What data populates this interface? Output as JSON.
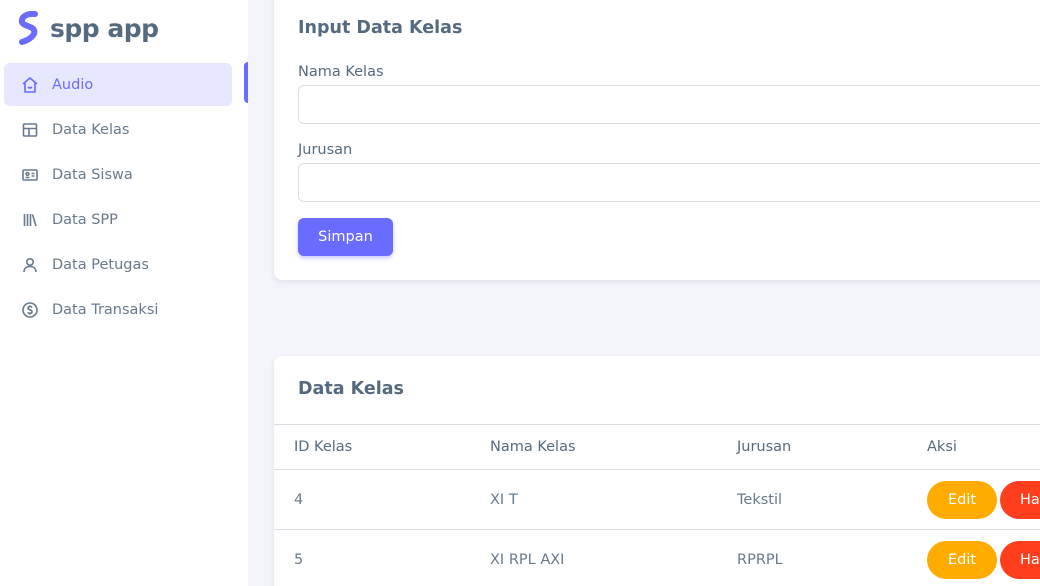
{
  "brand": {
    "name": "spp app",
    "accent": "#696cff"
  },
  "sidebar": {
    "items": [
      {
        "label": "Audio",
        "icon": "home-icon",
        "active": true
      },
      {
        "label": "Data Kelas",
        "icon": "layout-icon",
        "active": false
      },
      {
        "label": "Data Siswa",
        "icon": "id-card-icon",
        "active": false
      },
      {
        "label": "Data SPP",
        "icon": "library-icon",
        "active": false
      },
      {
        "label": "Data Petugas",
        "icon": "user-icon",
        "active": false
      },
      {
        "label": "Data Transaksi",
        "icon": "dollar-circle-icon",
        "active": false
      }
    ]
  },
  "form": {
    "title": "Input Data Kelas",
    "nama_kelas_label": "Nama Kelas",
    "nama_kelas_value": "",
    "jurusan_label": "Jurusan",
    "jurusan_value": "",
    "save_label": "Simpan"
  },
  "table": {
    "title": "Data Kelas",
    "headers": [
      "ID Kelas",
      "Nama Kelas",
      "Jurusan",
      "Aksi"
    ],
    "rows": [
      {
        "id": "4",
        "nama": "XI T",
        "jurusan": "Tekstil",
        "edit": "Edit",
        "hapus": "Ha"
      },
      {
        "id": "5",
        "nama": "XI RPL AXI",
        "jurusan": "RPRPL",
        "edit": "Edit",
        "hapus": "Ha"
      }
    ]
  },
  "colors": {
    "edit": "#ffab00",
    "delete": "#ff3e1d",
    "primary": "#696cff"
  }
}
